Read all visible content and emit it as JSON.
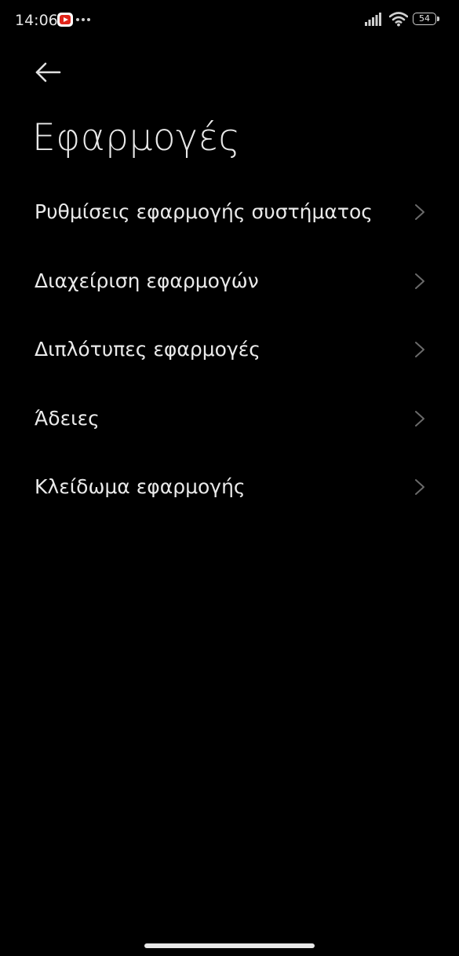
{
  "status_bar": {
    "time": "14:06",
    "battery_level": "54",
    "icons": [
      "youtube-icon",
      "more-dots-icon",
      "signal-icon",
      "wifi-icon",
      "battery-icon"
    ]
  },
  "header": {
    "back_icon": "arrow-left-icon",
    "title": "Εφαρμογές"
  },
  "list": {
    "items": [
      {
        "label": "Ρυθμίσεις εφαρμογής συστήματος",
        "icon": "chevron-right-icon"
      },
      {
        "label": "Διαχείριση εφαρμογών",
        "icon": "chevron-right-icon"
      },
      {
        "label": "Διπλότυπες εφαρμογές",
        "icon": "chevron-right-icon"
      },
      {
        "label": "Άδειες",
        "icon": "chevron-right-icon"
      },
      {
        "label": "Κλείδωμα εφαρμογής",
        "icon": "chevron-right-icon"
      }
    ]
  },
  "colors": {
    "background": "#000000",
    "text": "#eaeaea",
    "chevron": "#6a6a6a",
    "youtube_red": "#e1251b"
  }
}
